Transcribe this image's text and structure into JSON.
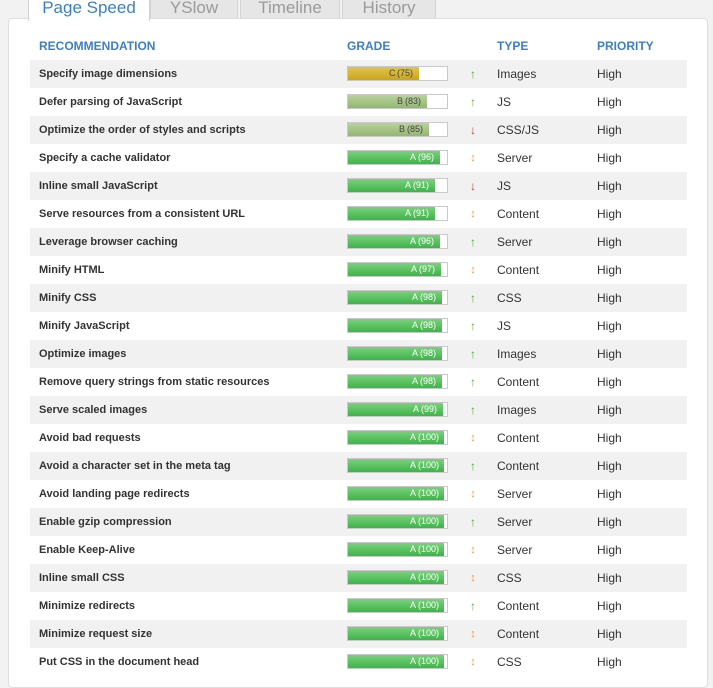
{
  "tabs": [
    {
      "label": "Page Speed",
      "active": true
    },
    {
      "label": "YSlow",
      "active": false
    },
    {
      "label": "Timeline",
      "active": false
    },
    {
      "label": "History",
      "active": false
    }
  ],
  "headers": {
    "recommendation": "RECOMMENDATION",
    "grade": "GRADE",
    "type": "TYPE",
    "priority": "PRIORITY"
  },
  "colors": {
    "grade_A": "#4cbd57",
    "grade_B": "#a3c383",
    "grade_C": "#d4b12f",
    "trend_up": "#5aac3e",
    "trend_down": "#d93232",
    "trend_flat": "#e8a046",
    "header_blue": "#3d7fc1"
  },
  "rows": [
    {
      "name": "Specify image dimensions",
      "grade": "C",
      "score": 75,
      "trend": "up",
      "type": "Images",
      "priority": "High"
    },
    {
      "name": "Defer parsing of JavaScript",
      "grade": "B",
      "score": 83,
      "trend": "up",
      "type": "JS",
      "priority": "High"
    },
    {
      "name": "Optimize the order of styles and scripts",
      "grade": "B",
      "score": 85,
      "trend": "down",
      "type": "CSS/JS",
      "priority": "High"
    },
    {
      "name": "Specify a cache validator",
      "grade": "A",
      "score": 96,
      "trend": "flat",
      "type": "Server",
      "priority": "High"
    },
    {
      "name": "Inline small JavaScript",
      "grade": "A",
      "score": 91,
      "trend": "down",
      "type": "JS",
      "priority": "High"
    },
    {
      "name": "Serve resources from a consistent URL",
      "grade": "A",
      "score": 91,
      "trend": "flat",
      "type": "Content",
      "priority": "High"
    },
    {
      "name": "Leverage browser caching",
      "grade": "A",
      "score": 96,
      "trend": "up",
      "type": "Server",
      "priority": "High"
    },
    {
      "name": "Minify HTML",
      "grade": "A",
      "score": 97,
      "trend": "flat",
      "type": "Content",
      "priority": "High"
    },
    {
      "name": "Minify CSS",
      "grade": "A",
      "score": 98,
      "trend": "up",
      "type": "CSS",
      "priority": "High"
    },
    {
      "name": "Minify JavaScript",
      "grade": "A",
      "score": 98,
      "trend": "up",
      "type": "JS",
      "priority": "High"
    },
    {
      "name": "Optimize images",
      "grade": "A",
      "score": 98,
      "trend": "up",
      "type": "Images",
      "priority": "High"
    },
    {
      "name": "Remove query strings from static resources",
      "grade": "A",
      "score": 98,
      "trend": "up",
      "type": "Content",
      "priority": "High"
    },
    {
      "name": "Serve scaled images",
      "grade": "A",
      "score": 99,
      "trend": "up",
      "type": "Images",
      "priority": "High"
    },
    {
      "name": "Avoid bad requests",
      "grade": "A",
      "score": 100,
      "trend": "flat",
      "type": "Content",
      "priority": "High"
    },
    {
      "name": "Avoid a character set in the meta tag",
      "grade": "A",
      "score": 100,
      "trend": "up",
      "type": "Content",
      "priority": "High"
    },
    {
      "name": "Avoid landing page redirects",
      "grade": "A",
      "score": 100,
      "trend": "flat",
      "type": "Server",
      "priority": "High"
    },
    {
      "name": "Enable gzip compression",
      "grade": "A",
      "score": 100,
      "trend": "up",
      "type": "Server",
      "priority": "High"
    },
    {
      "name": "Enable Keep-Alive",
      "grade": "A",
      "score": 100,
      "trend": "flat",
      "type": "Server",
      "priority": "High"
    },
    {
      "name": "Inline small CSS",
      "grade": "A",
      "score": 100,
      "trend": "flat",
      "type": "CSS",
      "priority": "High"
    },
    {
      "name": "Minimize redirects",
      "grade": "A",
      "score": 100,
      "trend": "up",
      "type": "Content",
      "priority": "High"
    },
    {
      "name": "Minimize request size",
      "grade": "A",
      "score": 100,
      "trend": "flat",
      "type": "Content",
      "priority": "High"
    },
    {
      "name": "Put CSS in the document head",
      "grade": "A",
      "score": 100,
      "trend": "flat",
      "type": "CSS",
      "priority": "High"
    }
  ]
}
